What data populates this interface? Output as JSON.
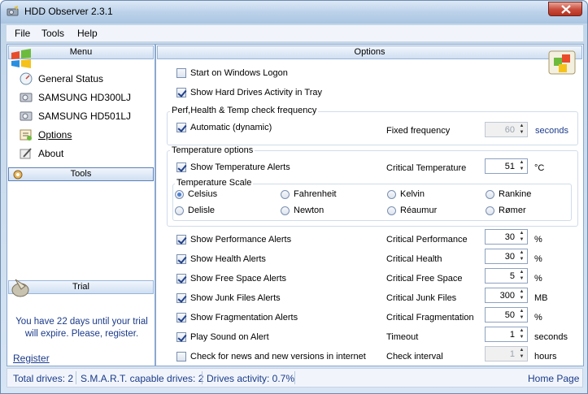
{
  "window": {
    "title": "HDD Observer 2.3.1"
  },
  "menu": {
    "file": "File",
    "tools": "Tools",
    "help": "Help"
  },
  "left": {
    "menu_header": "Menu",
    "items": [
      "General Status",
      "SAMSUNG HD300LJ",
      "SAMSUNG HD501LJ",
      "Options",
      "About"
    ],
    "tools_header": "Tools",
    "trial_header": "Trial",
    "trial_text": "You have 22 days until your trial will expire. Please, register.",
    "register": "Register"
  },
  "options": {
    "header": "Options",
    "start_logon": "Start on Windows Logon",
    "show_activity": "Show Hard Drives Activity in Tray",
    "freq_group": "Perf,Health & Temp check frequency",
    "automatic": "Automatic (dynamic)",
    "fixed_freq": "Fixed frequency",
    "fixed_freq_value": "60",
    "seconds": "seconds",
    "temp_group": "Temperature options",
    "show_temp": "Show Temperature Alerts",
    "crit_temp": "Critical Temperature",
    "crit_temp_value": "51",
    "celsius_unit": "°C",
    "scale_group": "Temperature Scale",
    "scales": [
      "Celsius",
      "Fahrenheit",
      "Kelvin",
      "Rankine",
      "Delisle",
      "Newton",
      "Réaumur",
      "Rømer"
    ],
    "alerts": [
      {
        "label": "Show Performance Alerts",
        "crit": "Critical Performance",
        "value": "30",
        "unit": "%"
      },
      {
        "label": "Show Health Alerts",
        "crit": "Critical Health",
        "value": "30",
        "unit": "%"
      },
      {
        "label": "Show Free Space Alerts",
        "crit": "Critical Free Space",
        "value": "5",
        "unit": "%"
      },
      {
        "label": "Show Junk Files Alerts",
        "crit": "Critical Junk Files",
        "value": "300",
        "unit": "MB"
      },
      {
        "label": "Show Fragmentation Alerts",
        "crit": "Critical Fragmentation",
        "value": "50",
        "unit": "%"
      },
      {
        "label": "Play Sound on Alert",
        "crit": "Timeout",
        "value": "1",
        "unit": "seconds"
      },
      {
        "label": "Check for news and new versions in internet",
        "crit": "Check interval",
        "value": "1",
        "unit": "hours"
      }
    ]
  },
  "status": {
    "total": "Total drives: 2",
    "smart": "S.M.A.R.T. capable drives: 2",
    "activity": "Drives activity: 0.7%",
    "home": "Home Page"
  },
  "colors": {
    "link": "#1a3a8a",
    "accent": "#4b7fd0"
  }
}
